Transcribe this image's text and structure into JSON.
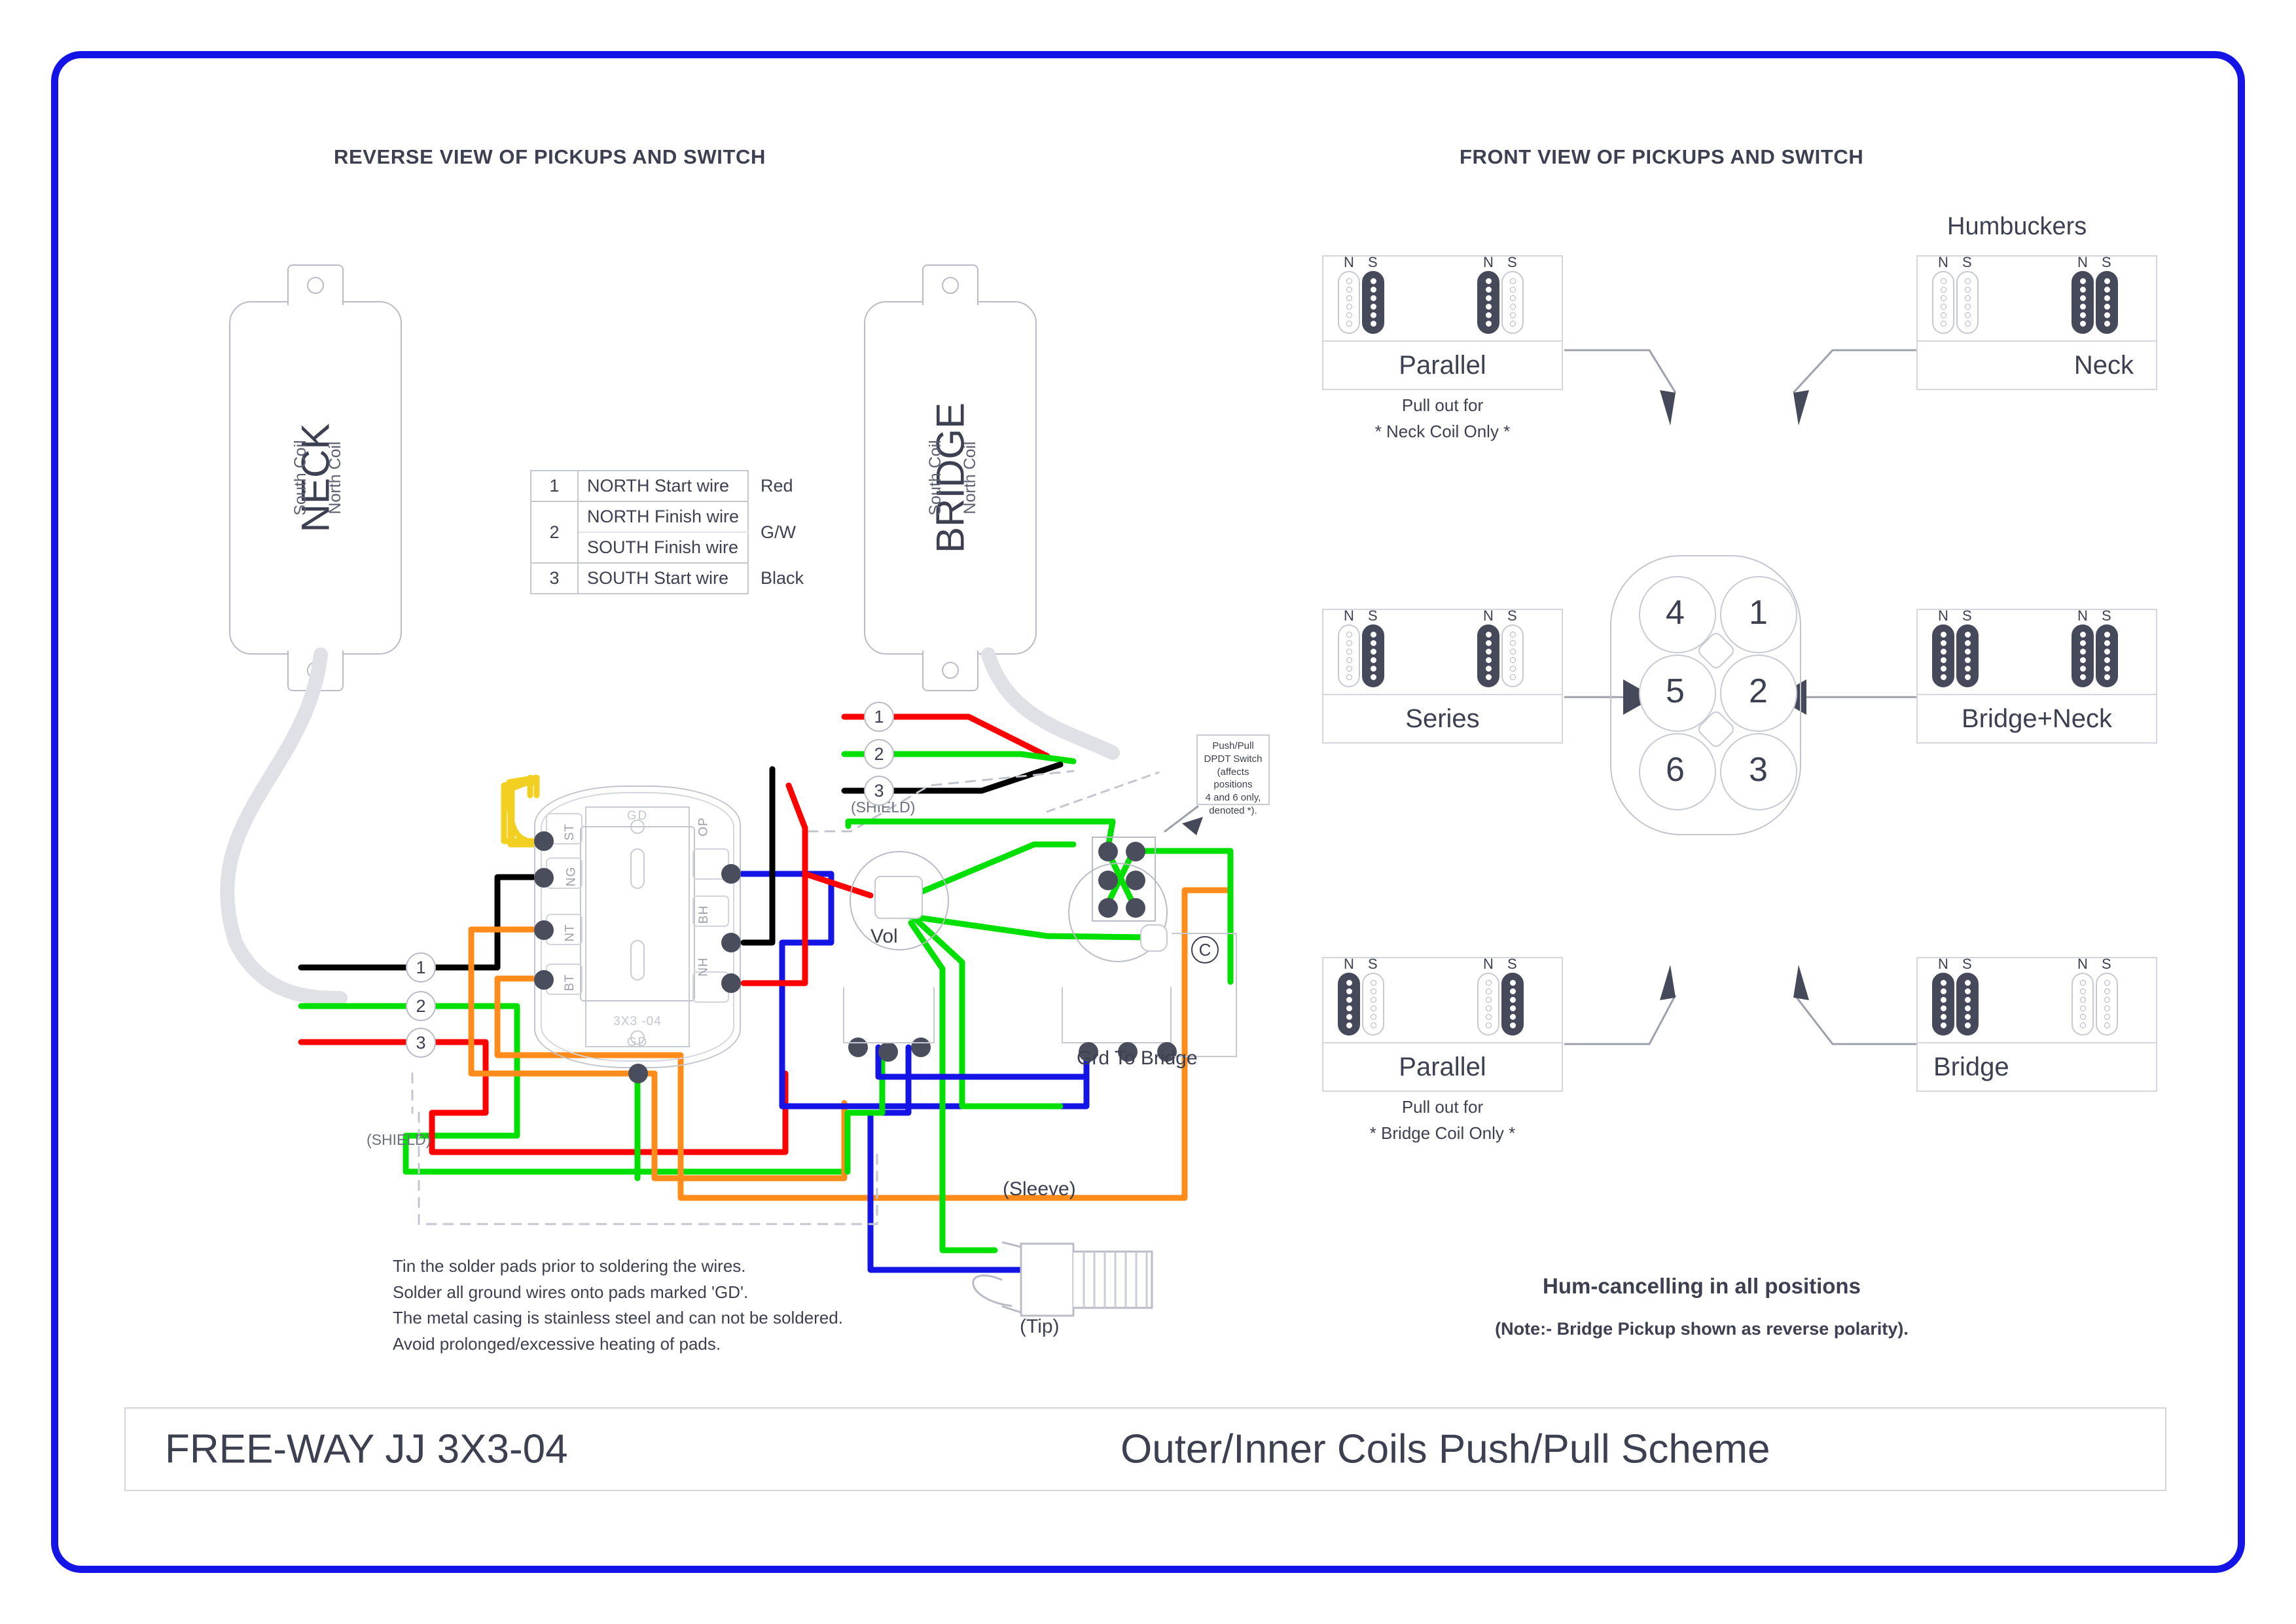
{
  "headers": {
    "left": "REVERSE VIEW OF PICKUPS AND SWITCH",
    "right": "FRONT VIEW OF PICKUPS AND SWITCH",
    "humbuckers": "Humbuckers"
  },
  "pickups": {
    "neck": {
      "name": "NECK",
      "south": "South Coil",
      "north": "North Coil"
    },
    "bridge": {
      "name": "BRIDGE",
      "south": "South Coil",
      "north": "North Coil"
    }
  },
  "wire_table": {
    "rows": [
      {
        "num": "1",
        "desc": "NORTH Start wire",
        "color": "Red"
      },
      {
        "num": "2",
        "desc_top": "NORTH Finish wire",
        "desc_bottom": "SOUTH Finish wire",
        "color": "G/W"
      },
      {
        "num": "3",
        "desc": "SOUTH Start wire",
        "color": "Black"
      }
    ]
  },
  "module": {
    "gd_top": "GD",
    "gd_bottom": "GD",
    "marking": "3X3      -04",
    "pads_left": [
      "ST",
      "NG",
      "NT",
      "BT"
    ],
    "pads_right": [
      "OP",
      "BH",
      "NH"
    ]
  },
  "pot": {
    "label": "Vol"
  },
  "cap": {
    "symbol": "C"
  },
  "pushpull": {
    "line1": "Push/Pull",
    "line2": "DPDT Switch",
    "line3": "(affects positions",
    "line4": "4 and 6 only,",
    "line5": "denoted *)."
  },
  "labels": {
    "grd_to_bridge": "Grd To Bridge",
    "sleeve": "(Sleeve)",
    "tip": "(Tip)",
    "shield_left": "(SHIELD)",
    "shield_right": "(SHIELD)"
  },
  "wire_numbers_bridge": [
    "1",
    "2",
    "3"
  ],
  "wire_numbers_neck": [
    "1",
    "2",
    "3"
  ],
  "instructions": [
    "Tin the solder pads prior to soldering the wires.",
    "Solder all ground wires onto pads marked 'GD'.",
    "The metal casing is stainless steel and can not be soldered.",
    "Avoid prolonged/excessive heating of pads."
  ],
  "hum_note": {
    "line1": "Hum-cancelling in all positions",
    "line2": "(Note:- Bridge Pickup shown as reverse polarity)."
  },
  "gate": {
    "positions_left": [
      "4",
      "5",
      "6"
    ],
    "positions_right": [
      "1",
      "2",
      "3"
    ]
  },
  "panels": [
    {
      "id": "left-top",
      "label": "Parallel",
      "sub1": "Pull out for",
      "sub2": "* Neck Coil Only *",
      "hb1": {
        "n_label": "N",
        "s_label": "S",
        "n_on": false,
        "s_on": true
      },
      "hb2": {
        "n_label": "N",
        "s_label": "S",
        "n_on": true,
        "s_on": false
      }
    },
    {
      "id": "left-mid",
      "label": "Series",
      "sub1": "",
      "sub2": "",
      "hb1": {
        "n_label": "N",
        "s_label": "S",
        "n_on": false,
        "s_on": true
      },
      "hb2": {
        "n_label": "N",
        "s_label": "S",
        "n_on": true,
        "s_on": false
      }
    },
    {
      "id": "left-bot",
      "label": "Parallel",
      "sub1": "Pull out for",
      "sub2": "* Bridge Coil Only *",
      "hb1": {
        "n_label": "N",
        "s_label": "S",
        "n_on": true,
        "s_on": false
      },
      "hb2": {
        "n_label": "N",
        "s_label": "S",
        "n_on": false,
        "s_on": true
      }
    },
    {
      "id": "right-top",
      "label": "Neck",
      "sub1": "",
      "sub2": "",
      "hb1": {
        "n_label": "N",
        "s_label": "S",
        "n_on": false,
        "s_on": false
      },
      "hb2": {
        "n_label": "N",
        "s_label": "S",
        "n_on": true,
        "s_on": true
      }
    },
    {
      "id": "right-mid",
      "label": "Bridge+Neck",
      "sub1": "",
      "sub2": "",
      "hb1": {
        "n_label": "N",
        "s_label": "S",
        "n_on": true,
        "s_on": true
      },
      "hb2": {
        "n_label": "N",
        "s_label": "S",
        "n_on": true,
        "s_on": true
      }
    },
    {
      "id": "right-bot",
      "label": "Bridge",
      "sub1": "",
      "sub2": "",
      "hb1": {
        "n_label": "N",
        "s_label": "S",
        "n_on": true,
        "s_on": true
      },
      "hb2": {
        "n_label": "N",
        "s_label": "S",
        "n_on": false,
        "s_on": false
      }
    }
  ],
  "title": {
    "model": "FREE-WAY JJ 3X3-04",
    "scheme": "Outer/Inner Coils Push/Pull Scheme"
  },
  "colors": {
    "border_blue": "#1414e6",
    "wire_red": "#ff0000",
    "wire_black": "#000000",
    "wire_green": "#00e000",
    "wire_blue": "#1414e6",
    "wire_orange": "#ff8c1a",
    "wire_yellow": "#f2d022",
    "ink": "#3d4050",
    "coil_fill": "#45495a"
  }
}
